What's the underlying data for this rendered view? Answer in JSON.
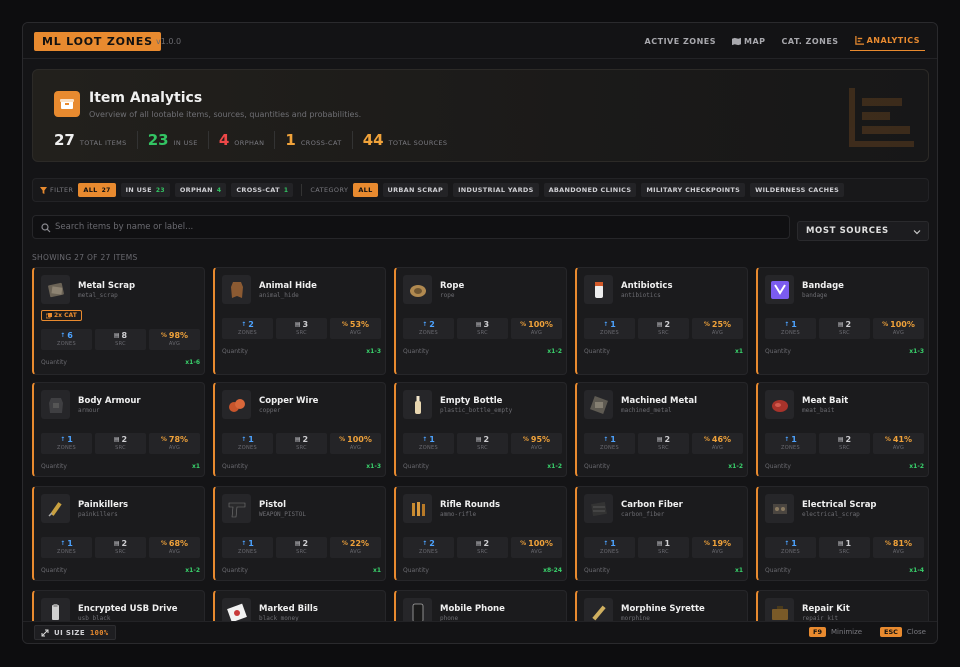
{
  "app": {
    "brand": "ML LOOT ZONES",
    "version": "v1.0.0"
  },
  "nav": [
    {
      "label": "ACTIVE ZONES",
      "icon": "",
      "active": false
    },
    {
      "label": "MAP",
      "icon": "map-icon",
      "active": false
    },
    {
      "label": "CAT. ZONES",
      "icon": "",
      "active": false
    },
    {
      "label": "ANALYTICS",
      "icon": "chart-icon",
      "active": true
    }
  ],
  "hero": {
    "title": "Item Analytics",
    "subtitle": "Overview of all lootable items, sources, quantities and probabilities.",
    "stats": [
      {
        "value": "27",
        "label": "TOTAL ITEMS",
        "color": "#f0f0f0"
      },
      {
        "value": "23",
        "label": "IN USE",
        "color": "#33c463"
      },
      {
        "value": "4",
        "label": "ORPHAN",
        "color": "#ee4848"
      },
      {
        "value": "1",
        "label": "CROSS-CAT",
        "color": "#f0a23a"
      },
      {
        "value": "44",
        "label": "TOTAL SOURCES",
        "color": "#f0a23a"
      }
    ]
  },
  "filters": {
    "label": "FILTER",
    "status": [
      {
        "label": "ALL",
        "count": "27",
        "active": true,
        "countColor": "#111"
      },
      {
        "label": "IN USE",
        "count": "23",
        "active": false,
        "countColor": "#33c463"
      },
      {
        "label": "ORPHAN",
        "count": "4",
        "active": false,
        "countColor": "#33c463"
      },
      {
        "label": "CROSS-CAT",
        "count": "1",
        "active": false,
        "countColor": "#33c463"
      }
    ],
    "category_label": "CATEGORY",
    "categories": [
      {
        "label": "ALL",
        "active": true
      },
      {
        "label": "URBAN SCRAP",
        "active": false
      },
      {
        "label": "INDUSTRIAL YARDS",
        "active": false
      },
      {
        "label": "ABANDONED CLINICS",
        "active": false
      },
      {
        "label": "MILITARY CHECKPOINTS",
        "active": false
      },
      {
        "label": "WILDERNESS CACHES",
        "active": false
      }
    ]
  },
  "search": {
    "placeholder": "Search items by name or label...",
    "value": ""
  },
  "sort": {
    "selected": "MOST SOURCES"
  },
  "showing": "SHOWING 27 OF 27 ITEMS",
  "labels": {
    "zones": "ZONES",
    "src": "SRC",
    "avg": "AVG",
    "quantity": "Quantity"
  },
  "items": [
    {
      "name": "Metal Scrap",
      "key": "metal_scrap",
      "icon": "metal-scrap-icon",
      "badge": "2x CAT",
      "zones": "6",
      "src": "8",
      "avg": "98%",
      "qty": "x1-6"
    },
    {
      "name": "Animal Hide",
      "key": "animal_hide",
      "icon": "animal-hide-icon",
      "zones": "2",
      "src": "3",
      "avg": "53%",
      "qty": "x1-3"
    },
    {
      "name": "Rope",
      "key": "rope",
      "icon": "rope-icon",
      "zones": "2",
      "src": "3",
      "avg": "100%",
      "qty": "x1-2"
    },
    {
      "name": "Antibiotics",
      "key": "antibiotics",
      "icon": "antibiotics-icon",
      "zones": "1",
      "src": "2",
      "avg": "25%",
      "qty": "x1"
    },
    {
      "name": "Bandage",
      "key": "bandage",
      "icon": "bandage-icon",
      "zones": "1",
      "src": "2",
      "avg": "100%",
      "qty": "x1-3"
    },
    {
      "name": "Body Armour",
      "key": "armour",
      "icon": "body-armour-icon",
      "zones": "1",
      "src": "2",
      "avg": "78%",
      "qty": "x1"
    },
    {
      "name": "Copper Wire",
      "key": "copper",
      "icon": "copper-wire-icon",
      "zones": "1",
      "src": "2",
      "avg": "100%",
      "qty": "x1-3"
    },
    {
      "name": "Empty Bottle",
      "key": "plastic_bottle_empty",
      "icon": "bottle-icon",
      "zones": "1",
      "src": "2",
      "avg": "95%",
      "qty": "x1-2"
    },
    {
      "name": "Machined Metal",
      "key": "machined_metal",
      "icon": "machined-metal-icon",
      "zones": "1",
      "src": "2",
      "avg": "46%",
      "qty": "x1-2"
    },
    {
      "name": "Meat Bait",
      "key": "meat_bait",
      "icon": "meat-bait-icon",
      "zones": "1",
      "src": "2",
      "avg": "41%",
      "qty": "x1-2"
    },
    {
      "name": "Painkillers",
      "key": "painkillers",
      "icon": "syringe-icon",
      "zones": "1",
      "src": "2",
      "avg": "68%",
      "qty": "x1-2"
    },
    {
      "name": "Pistol",
      "key": "WEAPON_PISTOL",
      "icon": "pistol-icon",
      "zones": "1",
      "src": "2",
      "avg": "22%",
      "qty": "x1"
    },
    {
      "name": "Rifle Rounds",
      "key": "ammo-rifle",
      "icon": "rifle-rounds-icon",
      "zones": "2",
      "src": "2",
      "avg": "100%",
      "qty": "x8-24"
    },
    {
      "name": "Carbon Fiber",
      "key": "carbon_fiber",
      "icon": "carbon-fiber-icon",
      "zones": "1",
      "src": "1",
      "avg": "19%",
      "qty": "x1"
    },
    {
      "name": "Electrical Scrap",
      "key": "electrical_scrap",
      "icon": "electrical-scrap-icon",
      "zones": "1",
      "src": "1",
      "avg": "81%",
      "qty": "x1-4"
    },
    {
      "name": "Encrypted USB Drive",
      "key": "usb_black",
      "icon": "usb-drive-icon"
    },
    {
      "name": "Marked Bills",
      "key": "black_money",
      "icon": "marked-bills-icon"
    },
    {
      "name": "Mobile Phone",
      "key": "phone",
      "icon": "mobile-phone-icon"
    },
    {
      "name": "Morphine Syrette",
      "key": "morphine",
      "icon": "morphine-icon"
    },
    {
      "name": "Repair Kit",
      "key": "repair_kit",
      "icon": "repair-kit-icon"
    }
  ],
  "footer": {
    "ui_size_label": "UI SIZE",
    "ui_size_value": "100%",
    "minimize_key": "F9",
    "minimize_label": "Minimize",
    "close_key": "ESC",
    "close_label": "Close"
  },
  "colors": {
    "accent": "#e88a2f",
    "zones": "#4da3ff",
    "avg": "#f0a23a",
    "qty": "#39d06b"
  }
}
